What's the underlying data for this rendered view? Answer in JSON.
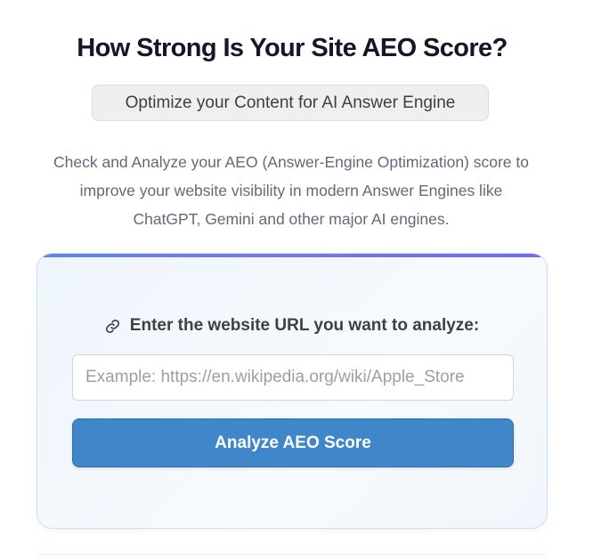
{
  "header": {
    "title": "How Strong Is Your Site AEO Score?",
    "subtitle": "Optimize your Content for AI Answer Engine",
    "description_lines": [
      "Check and Analyze your AEO (Answer-Engine Optimization) score to",
      "improve your website visibility in modern Answer Engines like",
      "ChatGPT, Gemini and other major AI engines."
    ]
  },
  "form": {
    "icon": "link-icon",
    "url_label": "Enter the website URL you want to analyze:",
    "url_value": "",
    "url_placeholder": "Example: https://en.wikipedia.org/wiki/Apple_Store",
    "submit_label": "Analyze AEO Score"
  },
  "colors": {
    "title": "#121826",
    "accent_gradient_start": "#5d86e8",
    "accent_gradient_end": "#6f6cf0",
    "button_background": "#3f87c9",
    "card_background": "#eef5fc"
  }
}
